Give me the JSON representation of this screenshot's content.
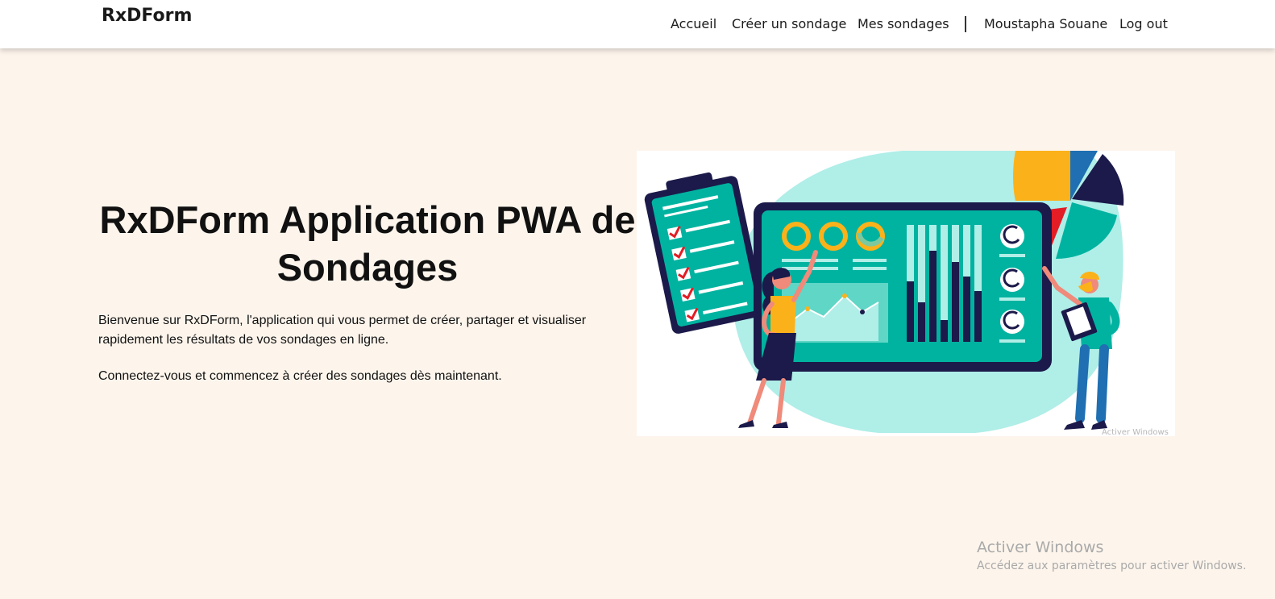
{
  "brand": "RxDForm",
  "nav": {
    "home": "Accueil",
    "create": "Créer un sondage",
    "my_surveys": "Mes sondages",
    "user": "Moustapha Souane",
    "logout": "Log out"
  },
  "hero": {
    "title": "RxDForm Application PWA de Sondages",
    "intro": "Bienvenue sur RxDForm, l'application qui vous permet de créer, partager et visualiser rapidement les résultats de vos sondages en ligne.",
    "cta": "Connectez-vous et commencez à créer des sondages dès maintenant."
  },
  "illustration": {
    "icon": "survey-dashboard-illustration",
    "colors": {
      "teal": "#00b3a0",
      "light_teal": "#b0eee8",
      "navy": "#1b1a4a",
      "yellow": "#fbb21a",
      "blue": "#1f6fb2",
      "red": "#e21d25",
      "skin": "#f08a7a"
    }
  },
  "watermark": {
    "overlay": "Activer Windows",
    "title": "Activer Windows",
    "subtitle": "Accédez aux paramètres pour activer Windows."
  }
}
